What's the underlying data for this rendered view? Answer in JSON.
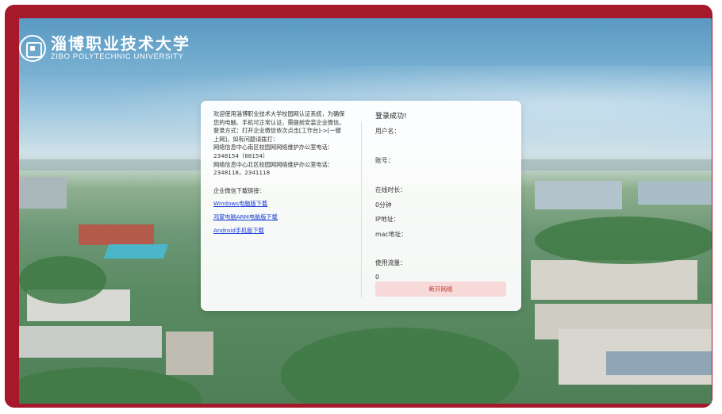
{
  "logo": {
    "name_cn": "淄博职业技术大学",
    "name_en": "ZIBO POLYTECHNIC UNIVERSITY"
  },
  "notice": {
    "lines": [
      "欢迎使用淄博职业技术大学校园网认证系统，为确保",
      "您的电脑、手机可正常认证，需提前安装企业微信。",
      "登录方式：打开企业微信依次点击[工作台]->[一键",
      "上网]，如有问题请拨打：",
      "网络信息中心南区校园网网络维护办公室电话：",
      "2348154（68154）",
      "网络信息中心北区校园网网络维护办公室电话：",
      "2348118，2341118"
    ],
    "download_title": "企业微信下载链接：",
    "links": [
      "Windows电脑版下载",
      "鸿蒙电脑ARM电脑版下载",
      "Android手机版下载"
    ]
  },
  "status": {
    "title": "登录成功!",
    "username_label": "用户名：",
    "account_label": "账号：",
    "duration_label": "在线时长：",
    "duration_value": "0分钟",
    "ip_label": "IP地址：",
    "mac_label": "mac地址：",
    "traffic_label": "使用流量：",
    "traffic_value": "0",
    "logout_label": "断开网络"
  },
  "colors": {
    "frame": "#a5192a",
    "link": "#1a3fd6",
    "logout_bg": "#f8d9d9",
    "logout_text": "#c0392b"
  }
}
